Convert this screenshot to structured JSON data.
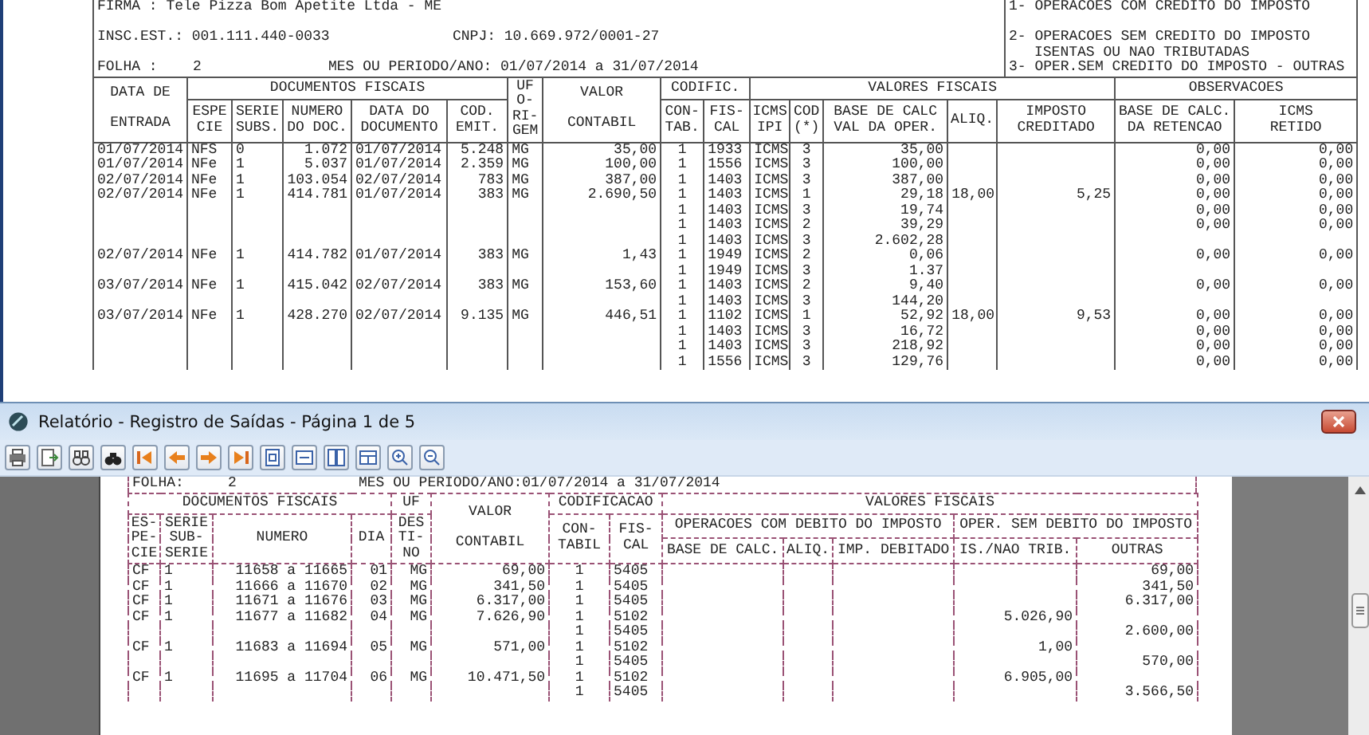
{
  "background_report": {
    "firma": "FIRMA : Tele Pizza Bom Apetite Ltda - ME",
    "insc_est": "INSC.EST.: 001.111.440-0033",
    "cnpj": "CNPJ: 10.669.972/0001-27",
    "folha_label": "FOLHA :",
    "folha": "2",
    "periodo": "MES OU PERIODO/ANO: 01/07/2014 a 31/07/2014",
    "legend": [
      {
        "kind": "item",
        "text": "1- OPERACOES COM CREDITO DO IMPOSTO"
      },
      {
        "kind": "item",
        "text": "2- OPERACOES SEM CREDITO DO IMPOSTO"
      },
      {
        "kind": "continuation",
        "text": "ISENTAS OU NAO TRIBUTADAS"
      },
      {
        "kind": "item",
        "text": "3- OPER.SEM CREDITO DO IMPOSTO - OUTRAS"
      }
    ],
    "table": {
      "groups": [
        "DATA DE\n\nENTRADA",
        "DOCUMENTOS FISCAIS",
        "UF\nO-\nRI-\nGEM",
        "VALOR\n\nCONTABIL",
        "CODIFIC.",
        "VALORES FISCAIS",
        "OBSERVACOES"
      ],
      "columns": [
        "ESPE\nCIE",
        "SERIE\nSUBS.",
        "NUMERO\nDO DOC.",
        "DATA  DO\nDOCUMENTO",
        "COD.\nEMIT.",
        "CON-\nTAB.",
        "FIS-\nCAL",
        "ICMS\nIPI",
        "COD\n(*)",
        "BASE DE CALC\nVAL DA OPER.",
        "ALIQ.",
        "IMPOSTO\nCREDITADO",
        "BASE DE CALC.\nDA RETENCAO",
        "ICMS\nRETIDO"
      ],
      "rows": [
        {
          "entrada": "01/07/2014",
          "especie": "NFS",
          "serie": "0",
          "numero": "1.072",
          "data_doc": "01/07/2014",
          "cod_emit": "5.248",
          "uf": "MG",
          "valor": "35,00",
          "contab": "1",
          "fiscal": "1933",
          "icms_ipi": "ICMS",
          "cod": "3",
          "base_calc": "35,00",
          "base_retencao": "0,00",
          "icms_retido": "0,00"
        },
        {
          "entrada": "01/07/2014",
          "especie": "NFe",
          "serie": "1",
          "numero": "5.037",
          "data_doc": "01/07/2014",
          "cod_emit": "2.359",
          "uf": "MG",
          "valor": "100,00",
          "contab": "1",
          "fiscal": "1556",
          "icms_ipi": "ICMS",
          "cod": "3",
          "base_calc": "100,00",
          "base_retencao": "0,00",
          "icms_retido": "0,00"
        },
        {
          "entrada": "02/07/2014",
          "especie": "NFe",
          "serie": "1",
          "numero": "103.054",
          "data_doc": "02/07/2014",
          "cod_emit": "783",
          "uf": "MG",
          "valor": "387,00",
          "contab": "1",
          "fiscal": "1403",
          "icms_ipi": "ICMS",
          "cod": "3",
          "base_calc": "387,00",
          "base_retencao": "0,00",
          "icms_retido": "0,00"
        },
        {
          "entrada": "02/07/2014",
          "especie": "NFe",
          "serie": "1",
          "numero": "414.781",
          "data_doc": "01/07/2014",
          "cod_emit": "383",
          "uf": "MG",
          "valor": "2.690,50",
          "contab": "1",
          "fiscal": "1403",
          "icms_ipi": "ICMS",
          "cod": "1",
          "base_calc": "29,18",
          "aliq": "18,00",
          "imposto_creditado": "5,25",
          "base_retencao": "0,00",
          "icms_retido": "0,00"
        },
        {
          "contab": "1",
          "fiscal": "1403",
          "icms_ipi": "ICMS",
          "cod": "3",
          "base_calc": "19,74",
          "base_retencao": "0,00",
          "icms_retido": "0,00"
        },
        {
          "contab": "1",
          "fiscal": "1403",
          "icms_ipi": "ICMS",
          "cod": "2",
          "base_calc": "39,29",
          "base_retencao": "0,00",
          "icms_retido": "0,00"
        },
        {
          "contab": "1",
          "fiscal": "1403",
          "icms_ipi": "ICMS",
          "cod": "3",
          "base_calc": "2.602,28"
        },
        {
          "entrada": "02/07/2014",
          "especie": "NFe",
          "serie": "1",
          "numero": "414.782",
          "data_doc": "01/07/2014",
          "cod_emit": "383",
          "uf": "MG",
          "valor": "1,43",
          "contab": "1",
          "fiscal": "1949",
          "icms_ipi": "ICMS",
          "cod": "2",
          "base_calc": "0,06",
          "base_retencao": "0,00",
          "icms_retido": "0,00"
        },
        {
          "contab": "1",
          "fiscal": "1949",
          "icms_ipi": "ICMS",
          "cod": "3",
          "base_calc": "1.37"
        },
        {
          "entrada": "03/07/2014",
          "especie": "NFe",
          "serie": "1",
          "numero": "415.042",
          "data_doc": "02/07/2014",
          "cod_emit": "383",
          "uf": "MG",
          "valor": "153,60",
          "contab": "1",
          "fiscal": "1403",
          "icms_ipi": "ICMS",
          "cod": "2",
          "base_calc": "9,40",
          "base_retencao": "0,00",
          "icms_retido": "0,00"
        },
        {
          "contab": "1",
          "fiscal": "1403",
          "icms_ipi": "ICMS",
          "cod": "3",
          "base_calc": "144,20"
        },
        {
          "entrada": "03/07/2014",
          "especie": "NFe",
          "serie": "1",
          "numero": "428.270",
          "data_doc": "02/07/2014",
          "cod_emit": "9.135",
          "uf": "MG",
          "valor": "446,51",
          "contab": "1",
          "fiscal": "1102",
          "icms_ipi": "ICMS",
          "cod": "1",
          "base_calc": "52,92",
          "aliq": "18,00",
          "imposto_creditado": "9,53",
          "base_retencao": "0,00",
          "icms_retido": "0,00"
        },
        {
          "contab": "1",
          "fiscal": "1403",
          "icms_ipi": "ICMS",
          "cod": "3",
          "base_calc": "16,72",
          "base_retencao": "0,00",
          "icms_retido": "0,00"
        },
        {
          "contab": "1",
          "fiscal": "1403",
          "icms_ipi": "ICMS",
          "cod": "3",
          "base_calc": "218,92",
          "base_retencao": "0,00",
          "icms_retido": "0,00"
        },
        {
          "contab": "1",
          "fiscal": "1556",
          "icms_ipi": "ICMS",
          "cod": "3",
          "base_calc": "129,76",
          "base_retencao": "0,00",
          "icms_retido": "0,00"
        }
      ]
    }
  },
  "window": {
    "title": "Relatório - Registro de Saídas - Página 1 de 5",
    "report": {
      "folha_label": "FOLHA:",
      "folha": "2",
      "periodo": "MES OU PERIODO/ANO:01/07/2014 a 31/07/2014",
      "groups": [
        "DOCUMENTOS FISCAIS",
        "UF",
        "VALOR\n\nCONTABIL",
        "CODIFICACAO",
        "VALORES FISCAIS"
      ],
      "subgroups": [
        "ES-\nPE-\nCIE",
        "SERIE\nSUB-\nSERIE",
        "NUMERO",
        "DIA",
        "DES\nTI-\nNO",
        "CON-\nTABIL",
        "FIS-\nCAL",
        "OPERACOES COM DEBITO DO IMPOSTO",
        "OPER. SEM DEBITO DO IMPOSTO"
      ],
      "columns": [
        "BASE DE CALC.",
        "ALIQ.",
        "IMP. DEBITADO",
        "IS./NAO TRIB.",
        "OUTRAS"
      ],
      "rows": [
        {
          "especie": "CF",
          "serie": "1",
          "numero": "11658 a 11665",
          "dia": "01",
          "uf": "MG",
          "valor": "69,00",
          "contabil": "1",
          "fiscal": "5405",
          "outras": "69,00"
        },
        {
          "especie": "CF",
          "serie": "1",
          "numero": "11666 a 11670",
          "dia": "02",
          "uf": "MG",
          "valor": "341,50",
          "contabil": "1",
          "fiscal": "5405",
          "outras": "341,50"
        },
        {
          "especie": "CF",
          "serie": "1",
          "numero": "11671 a 11676",
          "dia": "03",
          "uf": "MG",
          "valor": "6.317,00",
          "contabil": "1",
          "fiscal": "5405",
          "outras": "6.317,00"
        },
        {
          "especie": "CF",
          "serie": "1",
          "numero": "11677 a 11682",
          "dia": "04",
          "uf": "MG",
          "valor": "7.626,90",
          "contabil": "1",
          "fiscal": "5102",
          "isentas_nao_trib": "5.026,90"
        },
        {
          "contabil": "1",
          "fiscal": "5405",
          "outras": "2.600,00"
        },
        {
          "especie": "CF",
          "serie": "1",
          "numero": "11683 a 11694",
          "dia": "05",
          "uf": "MG",
          "valor": "571,00",
          "contabil": "1",
          "fiscal": "5102",
          "isentas_nao_trib": "1,00"
        },
        {
          "contabil": "1",
          "fiscal": "5405",
          "outras": "570,00"
        },
        {
          "especie": "CF",
          "serie": "1",
          "numero": "11695 a 11704",
          "dia": "06",
          "uf": "MG",
          "valor": "10.471,50",
          "contabil": "1",
          "fiscal": "5102",
          "isentas_nao_trib": "6.905,00"
        },
        {
          "contabil": "1",
          "fiscal": "5405",
          "outras": "3.566,50"
        }
      ]
    }
  }
}
